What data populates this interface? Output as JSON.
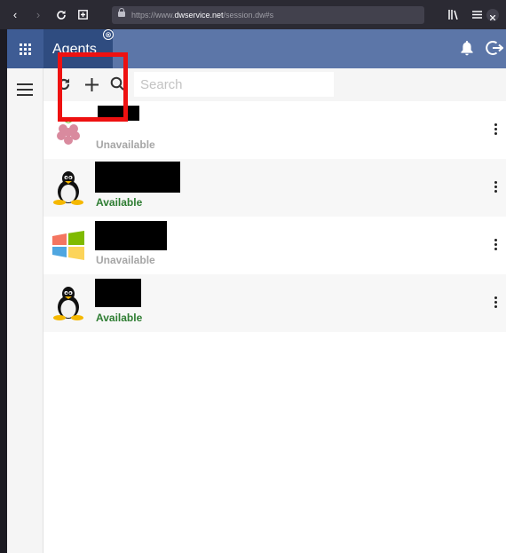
{
  "browser": {
    "back_icon": "‹",
    "forward_icon": "›",
    "url_prefix": "https://www.",
    "url_host": "dwservice.net",
    "url_path": "/session.dw#s"
  },
  "app": {
    "tab_title": "Agents",
    "tab_close": "⊗"
  },
  "toolbar": {
    "search_placeholder": "Search"
  },
  "agents": [
    {
      "os": "raspberry-pi",
      "status": "Unavailable",
      "available": false
    },
    {
      "os": "linux",
      "status": "Available",
      "available": true
    },
    {
      "os": "windows",
      "status": "Unavailable",
      "available": false
    },
    {
      "os": "linux",
      "status": "Available",
      "available": true
    }
  ],
  "colors": {
    "header": "#5c76a8",
    "active_tab": "#2f4c80",
    "available": "#2e7d32",
    "unavailable": "#a6a6a6",
    "highlight": "#ee1111"
  }
}
